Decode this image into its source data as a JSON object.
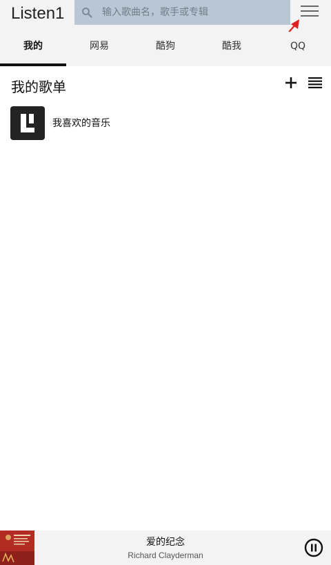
{
  "app": {
    "title": "Listen1"
  },
  "search": {
    "placeholder": "输入歌曲名，歌手或专辑",
    "value": ""
  },
  "tabs": [
    {
      "label": "我的",
      "active": true
    },
    {
      "label": "网易",
      "active": false
    },
    {
      "label": "酷狗",
      "active": false
    },
    {
      "label": "酷我",
      "active": false
    },
    {
      "label": "QQ",
      "active": false
    }
  ],
  "section": {
    "title": "我的歌单"
  },
  "playlists": [
    {
      "name": "我喜欢的音乐"
    }
  ],
  "player": {
    "title": "爱的纪念",
    "artist": "Richard Clayderman"
  },
  "colors": {
    "accent": "#111111",
    "arrow": "#e02020",
    "search_bg": "#b9c6d3",
    "bar_bg": "#f3f3f3"
  },
  "icons": [
    "search-icon",
    "menu-icon",
    "add-icon",
    "list-icon",
    "playlist-logo-icon",
    "pause-icon"
  ]
}
